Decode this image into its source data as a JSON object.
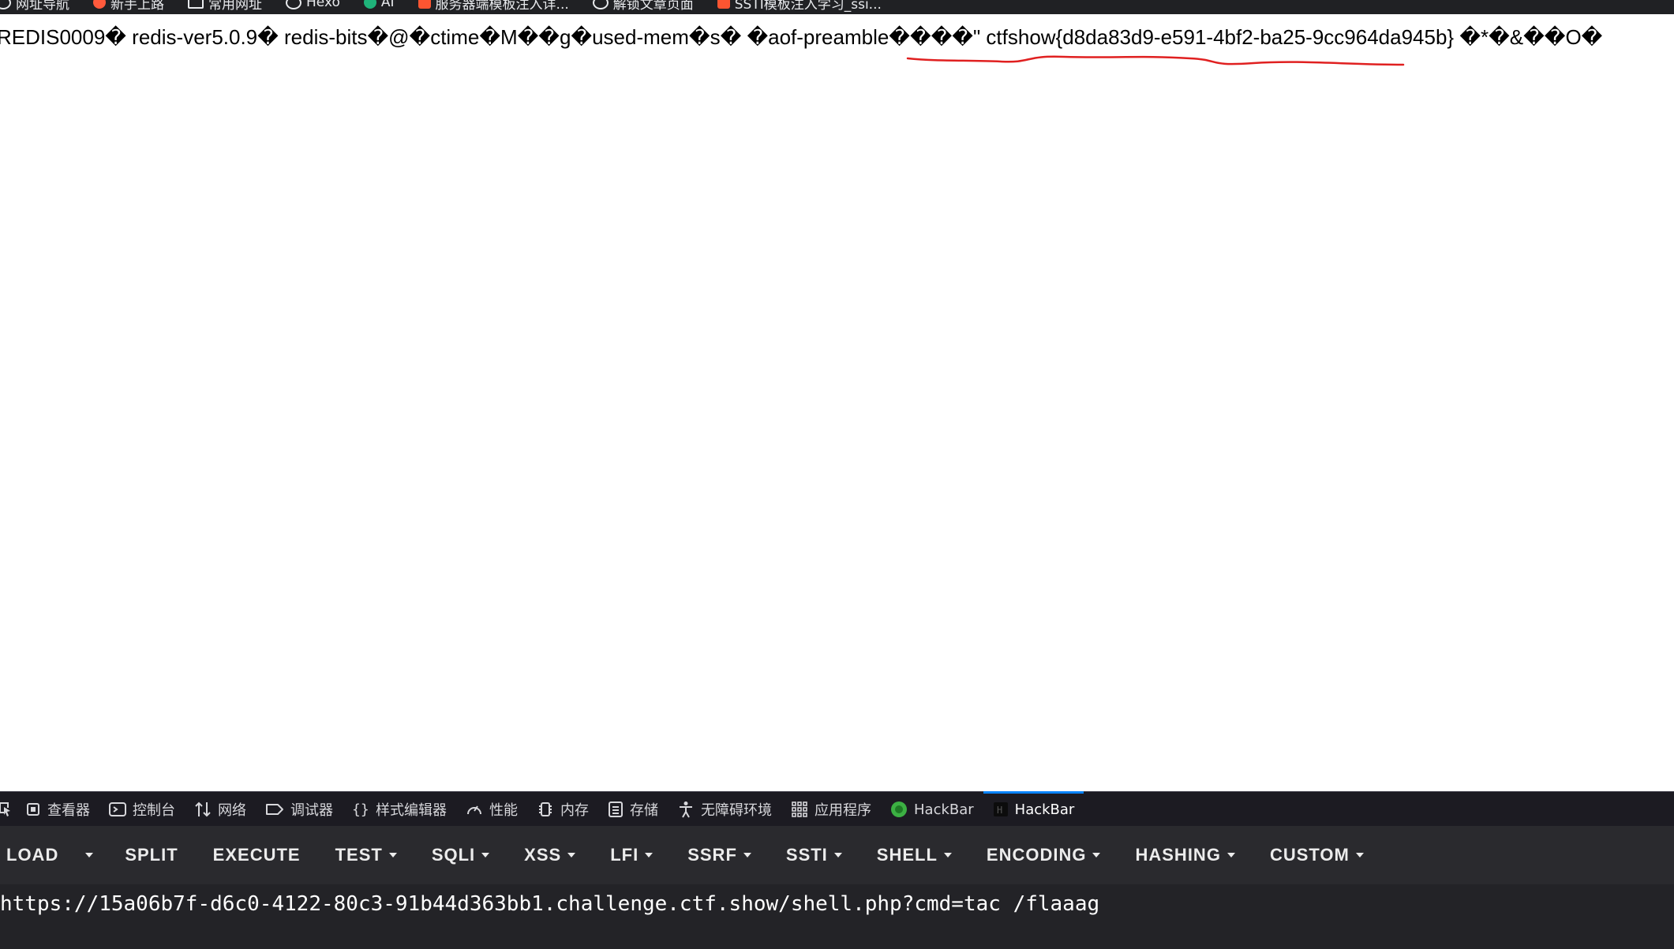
{
  "bookmarks": [
    {
      "label": "网址导航",
      "icon": "globe-icon",
      "color": "#e8eaed"
    },
    {
      "label": "新手上路",
      "icon": "firefox-icon",
      "color": "#ff5a3c"
    },
    {
      "label": "常用网址",
      "icon": "folder-icon",
      "color": "#e8eaed"
    },
    {
      "label": "Hexo",
      "icon": "globe-icon",
      "color": "#e8eaed"
    },
    {
      "label": "AI",
      "icon": "ai-icon",
      "color": "#1fb37a"
    },
    {
      "label": "服务器端模板注入详...",
      "icon": "csdn-icon",
      "color": "#fc5531"
    },
    {
      "label": "解锁文章页面",
      "icon": "globe-icon",
      "color": "#e8eaed"
    },
    {
      "label": "SSTI模板注入学习_ssi...",
      "icon": "csdn-icon",
      "color": "#fc5531"
    }
  ],
  "page": {
    "output_before_flag": "REDIS0009� redis-ver5.0.9� redis-bits�@�ctime�M��g�used-mem�s� �aof-preamble����\" ",
    "flag": "ctfshow{d8da83d9-e591-4bf2-ba25-9cc964da945b}",
    "output_after_flag": " �*�&��O�",
    "annotation_color": "#e02020"
  },
  "devtools": {
    "tabs": [
      {
        "label": "查看器",
        "icon": "inspector-icon"
      },
      {
        "label": "控制台",
        "icon": "console-icon"
      },
      {
        "label": "网络",
        "icon": "network-icon"
      },
      {
        "label": "调试器",
        "icon": "debugger-icon"
      },
      {
        "label": "样式编辑器",
        "icon": "style-editor-icon"
      },
      {
        "label": "性能",
        "icon": "performance-icon"
      },
      {
        "label": "内存",
        "icon": "memory-icon"
      },
      {
        "label": "存储",
        "icon": "storage-icon"
      },
      {
        "label": "无障碍环境",
        "icon": "accessibility-icon"
      },
      {
        "label": "应用程序",
        "icon": "application-icon"
      },
      {
        "label": "HackBar",
        "icon": "hackbar-green-icon"
      },
      {
        "label": "HackBar",
        "icon": "hackbar-dark-icon",
        "active": true
      }
    ],
    "accent": "#0a84ff"
  },
  "hackbar": {
    "buttons": [
      {
        "label": "LOAD",
        "dropdown": false
      },
      {
        "label": "SPLIT",
        "dropdown": false
      },
      {
        "label": "EXECUTE",
        "dropdown": false
      },
      {
        "label": "TEST",
        "dropdown": true
      },
      {
        "label": "SQLI",
        "dropdown": true
      },
      {
        "label": "XSS",
        "dropdown": true
      },
      {
        "label": "LFI",
        "dropdown": true
      },
      {
        "label": "SSRF",
        "dropdown": true
      },
      {
        "label": "SSTI",
        "dropdown": true
      },
      {
        "label": "SHELL",
        "dropdown": true
      },
      {
        "label": "ENCODING",
        "dropdown": true
      },
      {
        "label": "HASHING",
        "dropdown": true
      },
      {
        "label": "CUSTOM",
        "dropdown": true
      }
    ],
    "url_value": "https://15a06b7f-d6c0-4122-80c3-91b44d363bb1.challenge.ctf.show/shell.php?cmd=tac /flaaag"
  }
}
